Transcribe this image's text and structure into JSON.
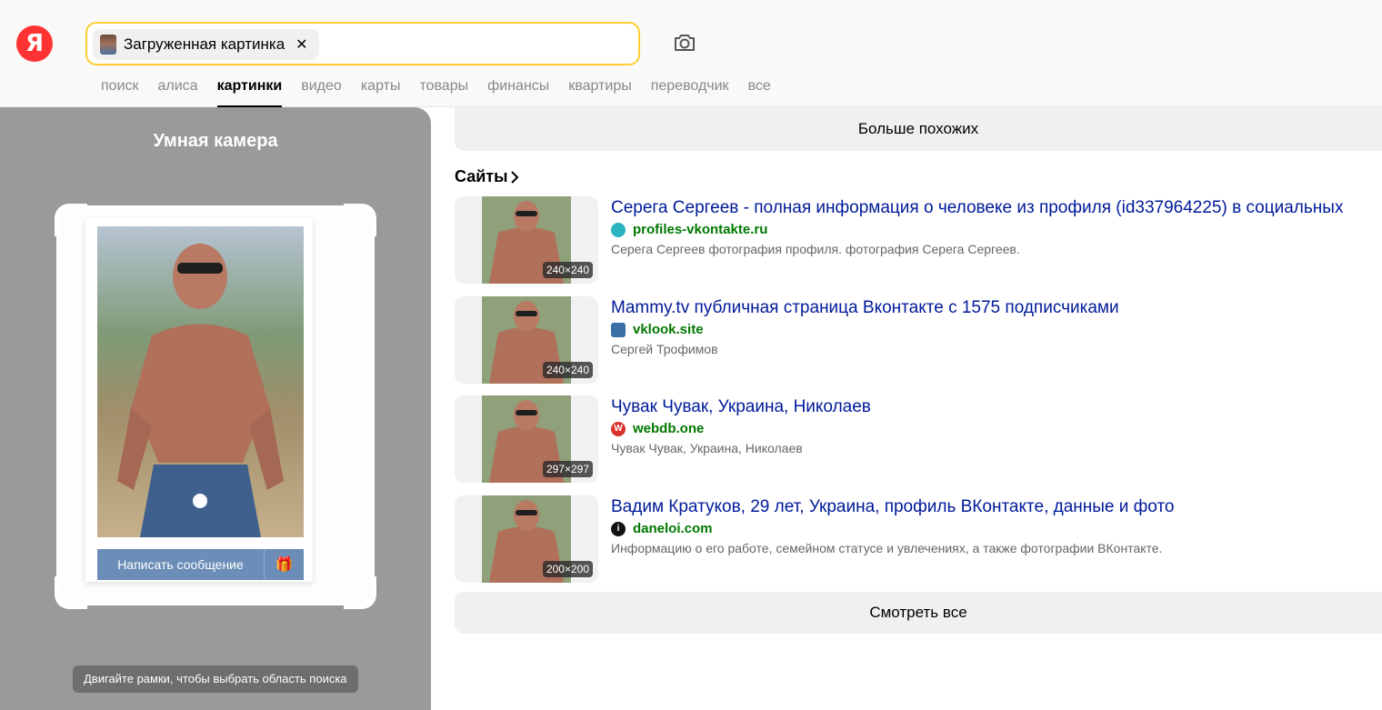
{
  "logo": {
    "glyph": "Я"
  },
  "search": {
    "chip_label": "Загруженная картинка",
    "chip_close": "✕"
  },
  "tabs": [
    {
      "label": "поиск"
    },
    {
      "label": "алиса"
    },
    {
      "label": "картинки"
    },
    {
      "label": "видео"
    },
    {
      "label": "карты"
    },
    {
      "label": "товары"
    },
    {
      "label": "финансы"
    },
    {
      "label": "квартиры"
    },
    {
      "label": "переводчик"
    },
    {
      "label": "все"
    }
  ],
  "active_tab": "картинки",
  "left_panel": {
    "title": "Умная камера",
    "card_button": "Написать сообщение",
    "hint": "Двигайте рамки, чтобы выбрать область поиска"
  },
  "right": {
    "more_button": "Больше похожих",
    "sites_title": "Сайты",
    "all_button": "Смотреть все",
    "results": [
      {
        "title": "Серега Сергеев - полная информация о человеке из профиля (id337964225) в социальных",
        "site": "profiles-vkontakte.ru",
        "desc": "Серега Сергеев фотография профиля. фотография Серега Сергеев.",
        "size": "240×240",
        "favicon_color": "#2bb3c0"
      },
      {
        "title": "Mammy.tv публичная страница Вконтакте с 1575 подписчиками",
        "site": "vklook.site",
        "desc": "Сергей Трофимов",
        "size": "240×240",
        "favicon_color": "#3a6ea5"
      },
      {
        "title": "Чувак Чувак, Украина, Николаев",
        "site": "webdb.one",
        "desc": "Чувак Чувак, Украина, Николаев",
        "size": "297×297",
        "favicon_color": "#d9312b"
      },
      {
        "title": "Вадим Кратуков, 29 лет, Украина, профиль ВКонтакте, данные и фото",
        "site": "daneloi.com",
        "desc": "Информацию о его работе, семейном статусе и увлечениях, а также фотографии ВКонтакте.",
        "size": "200×200",
        "favicon_color": "#111111"
      }
    ]
  },
  "colors": {
    "accent": "#ffcc33",
    "link": "#001a99",
    "site": "#007700",
    "logo": "#ff3333"
  }
}
